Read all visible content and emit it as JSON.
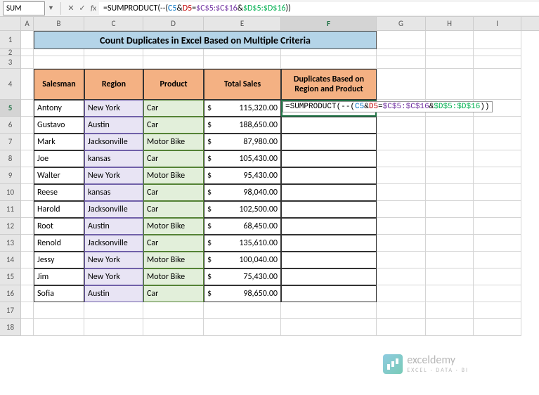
{
  "name_box": "SUM",
  "formula": "=SUMPRODUCT(--(C5&D5=$C$5:$C$16&$D$5:$D$16))",
  "cols": [
    "A",
    "B",
    "C",
    "D",
    "E",
    "F",
    "G",
    "H",
    "I"
  ],
  "title": "Count Duplicates in Excel Based on Multiple Criteria",
  "headers": {
    "salesman": "Salesman",
    "region": "Region",
    "product": "Product",
    "sales": "Total Sales",
    "dup": "Duplicates Based on Region and Product"
  },
  "rows": [
    {
      "n": 5,
      "s": "Antony",
      "r": "New York",
      "p": "Car",
      "v": "115,320.00"
    },
    {
      "n": 6,
      "s": "Gustavo",
      "r": "Austin",
      "p": "Car",
      "v": "188,650.00"
    },
    {
      "n": 7,
      "s": "Mark",
      "r": "Jacksonville",
      "p": "Motor Bike",
      "v": "87,980.00"
    },
    {
      "n": 8,
      "s": "Joe",
      "r": "kansas",
      "p": "Car",
      "v": "105,430.00"
    },
    {
      "n": 9,
      "s": "Walter",
      "r": "New York",
      "p": "Motor Bike",
      "v": "95,430.00"
    },
    {
      "n": 10,
      "s": "Reese",
      "r": "kansas",
      "p": "Car",
      "v": "98,040.00"
    },
    {
      "n": 11,
      "s": "Harold",
      "r": "Jacksonville",
      "p": "Car",
      "v": "102,500.00"
    },
    {
      "n": 12,
      "s": "Root",
      "r": "Austin",
      "p": "Motor Bike",
      "v": "68,450.00"
    },
    {
      "n": 13,
      "s": "Renold",
      "r": "Jacksonville",
      "p": "Car",
      "v": "135,610.00"
    },
    {
      "n": 14,
      "s": "Jessy",
      "r": "New York",
      "p": "Motor Bike",
      "v": "100,040.00"
    },
    {
      "n": 15,
      "s": "Jim",
      "r": "New York",
      "p": "Motor Bike",
      "v": "75,430.00"
    },
    {
      "n": 16,
      "s": "Sofia",
      "r": "Austin",
      "p": "Car",
      "v": "98,650.00"
    }
  ],
  "currency": "$",
  "watermark": {
    "title": "exceldemy",
    "sub": "EXCEL · DATA · BI"
  },
  "formula_parts": {
    "p1": "=SUMPRODUCT(",
    "p2": "--(",
    "p3": "C5",
    "amp1": "&",
    "p4": "D5",
    "eq": "=",
    "p5": "$C$5:$C$16",
    "amp2": "&",
    "p6": "$D$5:$D$16",
    "p7": ")",
    "p8": ")"
  }
}
